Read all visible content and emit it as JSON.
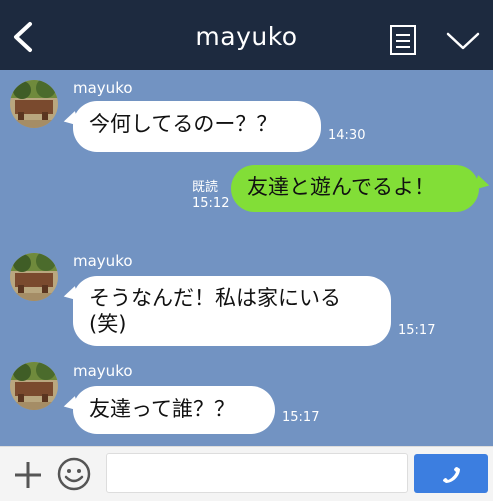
{
  "header": {
    "title": "mayuko"
  },
  "messages": [
    {
      "sender": "mayuko",
      "text": "今何してるのー？？",
      "time": "14:30"
    },
    {
      "text": "友達と遊んでるよ！",
      "read": "既読",
      "time": "15:12"
    },
    {
      "sender": "mayuko",
      "text": "そうなんだ！私は家にいる(笑)",
      "time": "15:17"
    },
    {
      "sender": "mayuko",
      "text": "友達って誰？？",
      "time": "15:17"
    }
  ],
  "input": {
    "value": "",
    "placeholder": ""
  },
  "colors": {
    "header_bg": "#1d2a3f",
    "chat_bg": "#7293c2",
    "incoming_bubble": "#ffffff",
    "outgoing_bubble": "#82de37",
    "call_button": "#3c7ee0"
  },
  "icons": [
    "back-arrow-icon",
    "memo-icon",
    "chevron-down-icon",
    "plus-icon",
    "emoji-icon",
    "phone-icon"
  ]
}
